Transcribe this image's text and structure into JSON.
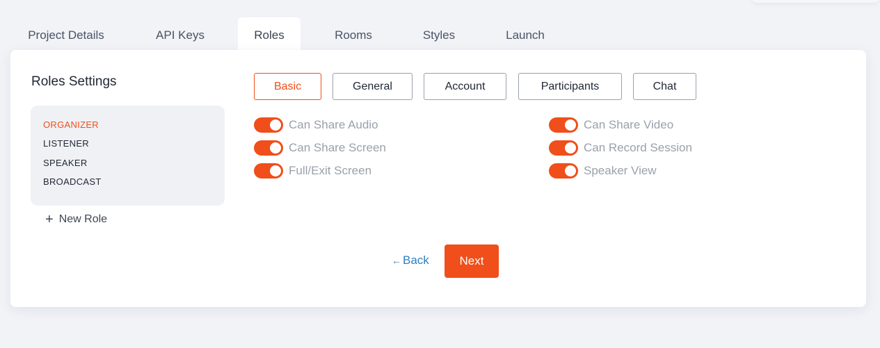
{
  "tabs": [
    {
      "label": "Project Details"
    },
    {
      "label": "API Keys"
    },
    {
      "label": "Roles"
    },
    {
      "label": "Rooms"
    },
    {
      "label": "Styles"
    },
    {
      "label": "Launch"
    }
  ],
  "active_tab": "Roles",
  "roles_panel": {
    "title": "Roles Settings",
    "roles": [
      {
        "label": "ORGANIZER",
        "active": true
      },
      {
        "label": "LISTENER"
      },
      {
        "label": "SPEAKER"
      },
      {
        "label": "BROADCAST"
      }
    ],
    "new_role_label": "New Role",
    "new_role_icon": "plus-icon"
  },
  "subtabs": [
    {
      "label": "Basic",
      "active": true
    },
    {
      "label": "General"
    },
    {
      "label": "Account"
    },
    {
      "label": "Participants"
    },
    {
      "label": "Chat"
    }
  ],
  "toggles": [
    {
      "label": "Can Share Audio",
      "on": true
    },
    {
      "label": "Can Share Video",
      "on": true
    },
    {
      "label": "Can Share Screen",
      "on": true
    },
    {
      "label": "Can Record Session",
      "on": true
    },
    {
      "label": "Full/Exit Screen",
      "on": true
    },
    {
      "label": "Speaker View",
      "on": true
    }
  ],
  "actions": {
    "back_label": "Back",
    "back_icon": "arrow-left-icon",
    "next_label": "Next"
  },
  "colors": {
    "accent": "#f04e1a",
    "link": "#2f7fbf",
    "background": "#f1f3f7"
  }
}
